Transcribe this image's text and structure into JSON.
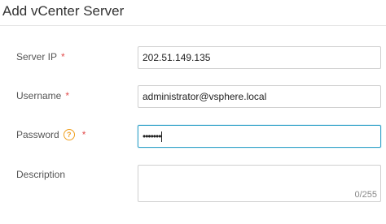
{
  "dialog": {
    "title": "Add vCenter Server"
  },
  "form": {
    "server_ip": {
      "label": "Server IP",
      "required_mark": "*",
      "value": "202.51.149.135"
    },
    "username": {
      "label": "Username",
      "required_mark": "*",
      "value": "administrator@vsphere.local"
    },
    "password": {
      "label": "Password",
      "help_icon": "?",
      "required_mark": "*",
      "masked_value": "•••••••"
    },
    "description": {
      "label": "Description",
      "value": "",
      "char_count": "0/255"
    }
  },
  "colors": {
    "required": "#e24c4c",
    "help_icon": "#f0a020",
    "focus_border": "#33a3c9"
  },
  "icons": {
    "help": "question-circle-icon"
  }
}
